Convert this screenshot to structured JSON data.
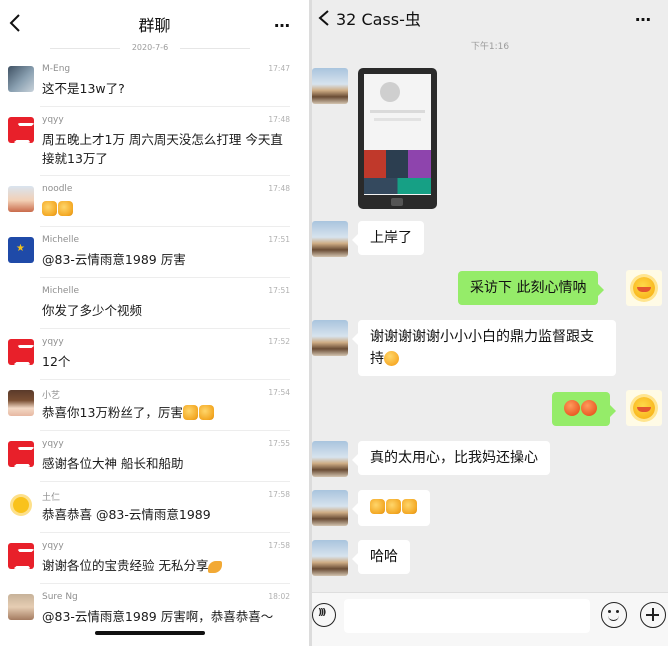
{
  "left": {
    "title": "群聊",
    "date": "2020-7-6",
    "more_icon": "…",
    "messages": [
      {
        "name": "M-Eng",
        "time": "17:47",
        "text": "这不是13w了?",
        "avatar": "landscape-avatar"
      },
      {
        "name": "yqyy",
        "time": "17:48",
        "text": "周五晚上才1万 周六周天没怎么打理 今天直接就13万了",
        "avatar": "red-s-logo-avatar"
      },
      {
        "name": "noodle",
        "time": "17:48",
        "text": "",
        "avatar": "kid-photo-avatar"
      },
      {
        "name": "Michelle",
        "time": "17:51",
        "text": "@83-云情雨意1989 厉害",
        "avatar": "blue-star-avatar"
      },
      {
        "name": "Michelle",
        "time": "17:51",
        "text": "你发了多少个视频",
        "avatar": ""
      },
      {
        "name": "yqyy",
        "time": "17:52",
        "text": "12个",
        "avatar": "red-s-logo-avatar"
      },
      {
        "name": "小艺",
        "time": "17:54",
        "text": "恭喜你13万粉丝了，厉害",
        "avatar": "girl-avatar"
      },
      {
        "name": "yqyy",
        "time": "17:55",
        "text": "感谢各位大神 船长和船助",
        "avatar": "red-s-logo-avatar"
      },
      {
        "name": "土仁",
        "time": "17:58",
        "text": "恭喜恭喜 @83-云情雨意1989",
        "avatar": "sun-avatar"
      },
      {
        "name": "yqyy",
        "time": "17:58",
        "text": "谢谢各位的宝贵经验 无私分享",
        "avatar": "red-s-logo-avatar"
      },
      {
        "name": "Sure Ng",
        "time": "18:02",
        "text": "@83-云情雨意1989 厉害啊，恭喜恭喜～",
        "avatar": "face-avatar"
      }
    ]
  },
  "right": {
    "title": "32  Cass-虫",
    "time": "下午1:16",
    "more_icon": "…",
    "messages": {
      "m1": "上岸了",
      "m2": "采访下  此刻心情呐",
      "m3": "谢谢谢谢谢小小小白的鼎力监督跟支持",
      "m5": "真的太用心，比我妈还操心",
      "m7": "哈哈"
    }
  },
  "colors": {
    "self_bubble": "#95ec69",
    "other_bubble": "#ffffff",
    "chat_background": "#ededed"
  }
}
